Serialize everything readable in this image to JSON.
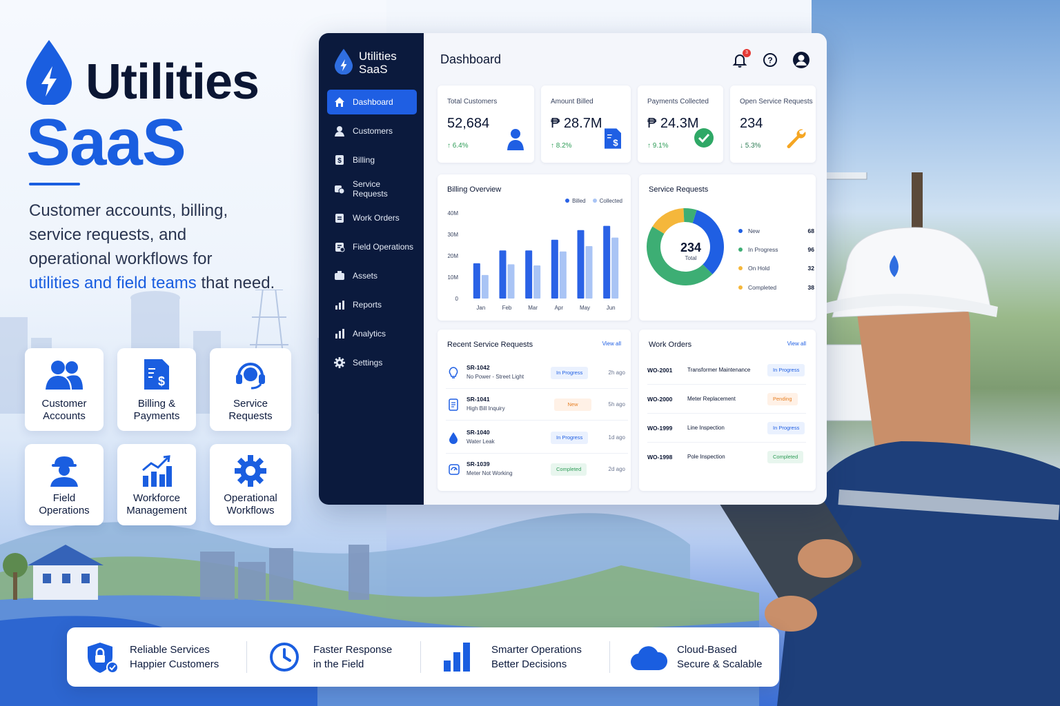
{
  "brand": {
    "title": "Utilities",
    "subtitle": "SaaS",
    "tagline_1": "Customer accounts, billing,",
    "tagline_2": "service requests, and",
    "tagline_3": "operational workflows for",
    "tagline_highlight": "utilities and field teams",
    "tagline_end": " that need.",
    "accent_color": "#1a5ee0"
  },
  "tiles": [
    {
      "line1": "Customer",
      "line2": "Accounts",
      "icon": "users-icon"
    },
    {
      "line1": "Billing &",
      "line2": "Payments",
      "icon": "invoice-icon"
    },
    {
      "line1": "Service",
      "line2": "Requests",
      "icon": "headset-icon"
    },
    {
      "line1": "Field",
      "line2": "Operations",
      "icon": "worker-icon"
    },
    {
      "line1": "Workforce",
      "line2": "Management",
      "icon": "growth-chart-icon"
    },
    {
      "line1": "Operational",
      "line2": "Workflows",
      "icon": "gear-icon"
    }
  ],
  "dashboard": {
    "app_name_1": "Utilities",
    "app_name_2": "SaaS",
    "page_title": "Dashboard",
    "notification_count": "3",
    "nav": [
      {
        "label": "Dashboard",
        "icon": "home-icon",
        "active": true
      },
      {
        "label": "Customers",
        "icon": "user-icon"
      },
      {
        "label": "Billing",
        "icon": "dollar-doc-icon"
      },
      {
        "label": "Service Requests",
        "icon": "service-icon"
      },
      {
        "label": "Work Orders",
        "icon": "clipboard-icon"
      },
      {
        "label": "Field Operations",
        "icon": "field-icon"
      },
      {
        "label": "Assets",
        "icon": "assets-icon"
      },
      {
        "label": "Reports",
        "icon": "reports-icon"
      },
      {
        "label": "Analytics",
        "icon": "analytics-icon"
      },
      {
        "label": "Settings",
        "icon": "gear-icon"
      }
    ],
    "kpis": [
      {
        "label": "Total Customers",
        "value": "52,684",
        "delta": "6.4%",
        "direction": "up",
        "icon": "user-icon"
      },
      {
        "label": "Amount Billed",
        "value": "₱ 28.7M",
        "delta": "8.2%",
        "direction": "up",
        "icon": "invoice-icon"
      },
      {
        "label": "Payments Collected",
        "value": "₱ 24.3M",
        "delta": "9.1%",
        "direction": "up",
        "icon": "check-circle-icon"
      },
      {
        "label": "Open Service Requests",
        "value": "234",
        "delta": "5.3%",
        "direction": "down",
        "icon": "wrench-icon"
      }
    ],
    "billing_overview": {
      "title": "Billing Overview",
      "legend_billed": "Billed",
      "legend_collected": "Collected"
    },
    "service_requests": {
      "title": "Service Requests",
      "total": "234",
      "total_label": "Total",
      "statuses": [
        {
          "label": "New",
          "count": "68",
          "color": "#1f5fe3"
        },
        {
          "label": "In Progress",
          "count": "96",
          "color": "#3dae74"
        },
        {
          "label": "On Hold",
          "count": "32",
          "color": "#f5b73b"
        },
        {
          "label": "Completed",
          "count": "38",
          "color": "#f5b73b"
        }
      ]
    },
    "recent_requests": {
      "title": "Recent Service Requests",
      "view_all": "View all",
      "rows": [
        {
          "id": "SR-1042",
          "desc": "No Power - Street Light",
          "status": "In Progress",
          "kind": "prog",
          "time": "2h ago",
          "icon": "lightbulb-icon"
        },
        {
          "id": "SR-1041",
          "desc": "High Bill Inquiry",
          "status": "New",
          "kind": "new",
          "time": "5h ago",
          "icon": "document-icon"
        },
        {
          "id": "SR-1040",
          "desc": "Water Leak",
          "status": "In Progress",
          "kind": "prog",
          "time": "1d ago",
          "icon": "water-drop-icon"
        },
        {
          "id": "SR-1039",
          "desc": "Meter Not Working",
          "status": "Completed",
          "kind": "done",
          "time": "2d ago",
          "icon": "meter-icon"
        }
      ]
    },
    "work_orders": {
      "title": "Work Orders",
      "view_all": "View all",
      "rows": [
        {
          "id": "WO-2001",
          "desc": "Transformer Maintenance",
          "status": "In Progress",
          "kind": "prog"
        },
        {
          "id": "WO-2000",
          "desc": "Meter Replacement",
          "status": "Pending",
          "kind": "pend"
        },
        {
          "id": "WO-1999",
          "desc": "Line Inspection",
          "status": "In Progress",
          "kind": "prog"
        },
        {
          "id": "WO-1998",
          "desc": "Pole Inspection",
          "status": "Completed",
          "kind": "done"
        }
      ]
    }
  },
  "chart_data": {
    "type": "bar",
    "title": "Billing Overview",
    "categories": [
      "Jan",
      "Feb",
      "Mar",
      "Apr",
      "May",
      "Jun"
    ],
    "series": [
      {
        "name": "Billed",
        "values": [
          16.5,
          22.5,
          22.5,
          27.5,
          32,
          34
        ],
        "color": "#2a62e6"
      },
      {
        "name": "Collected",
        "values": [
          11,
          16,
          15.5,
          22,
          24.5,
          28.5
        ],
        "color": "#a9c4f5"
      }
    ],
    "y_ticks": [
      "0",
      "10M",
      "20M",
      "30M",
      "40M"
    ],
    "ylim": [
      0,
      40
    ],
    "legend": "top-right",
    "grid": false
  },
  "benefits": [
    {
      "line1": "Reliable Services",
      "line2": "Happier Customers",
      "icon": "shield-lock-icon"
    },
    {
      "line1": "Faster Response",
      "line2": "in the Field",
      "icon": "clock-icon"
    },
    {
      "line1": "Smarter Operations",
      "line2": "Better Decisions",
      "icon": "bar-chart-icon"
    },
    {
      "line1": "Cloud-Based",
      "line2": "Secure & Scalable",
      "icon": "cloud-icon"
    }
  ]
}
